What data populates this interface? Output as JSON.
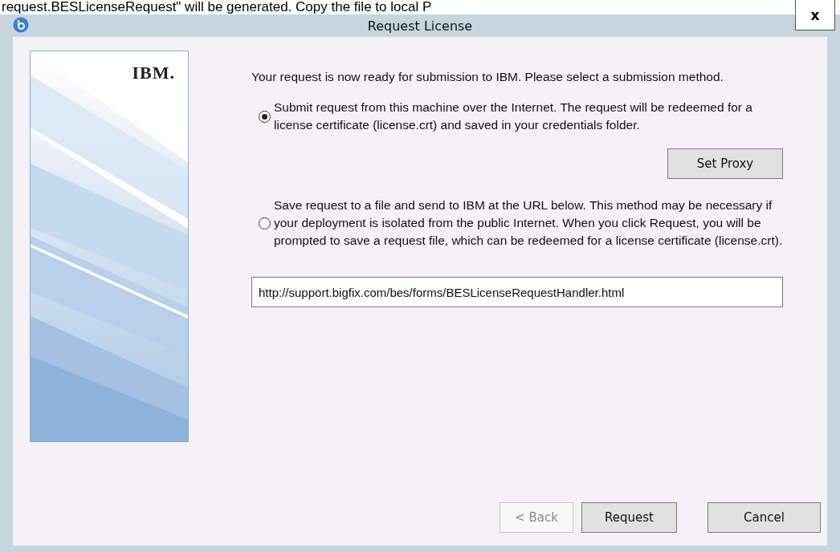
{
  "caption": "request.BESLicenseRequest\" will be generated. Copy the file to local P",
  "window": {
    "title": "Request License",
    "close": "x"
  },
  "logo": "IBM.",
  "intro": "Your request is now ready for submission to IBM.  Please select a submission method.",
  "options": [
    {
      "label": "Submit request from this machine over the Internet.  The request will be redeemed for a license certificate (license.crt) and saved in your credentials folder.",
      "selected": true
    },
    {
      "label": "Save request to a file and send to IBM at the URL below.  This method may be necessary if your deployment is isolated from the public Internet.  When you click Request, you will be prompted to save a request file, which can be redeemed for a license certificate (license.crt).",
      "selected": false
    }
  ],
  "set_proxy": "Set Proxy",
  "url": "http://support.bigfix.com/bes/forms/BESLicenseRequestHandler.html",
  "buttons": [
    {
      "label": "< Back",
      "disabled": true
    },
    {
      "label": "Request",
      "disabled": false
    },
    {
      "label": "Cancel",
      "disabled": false
    }
  ]
}
